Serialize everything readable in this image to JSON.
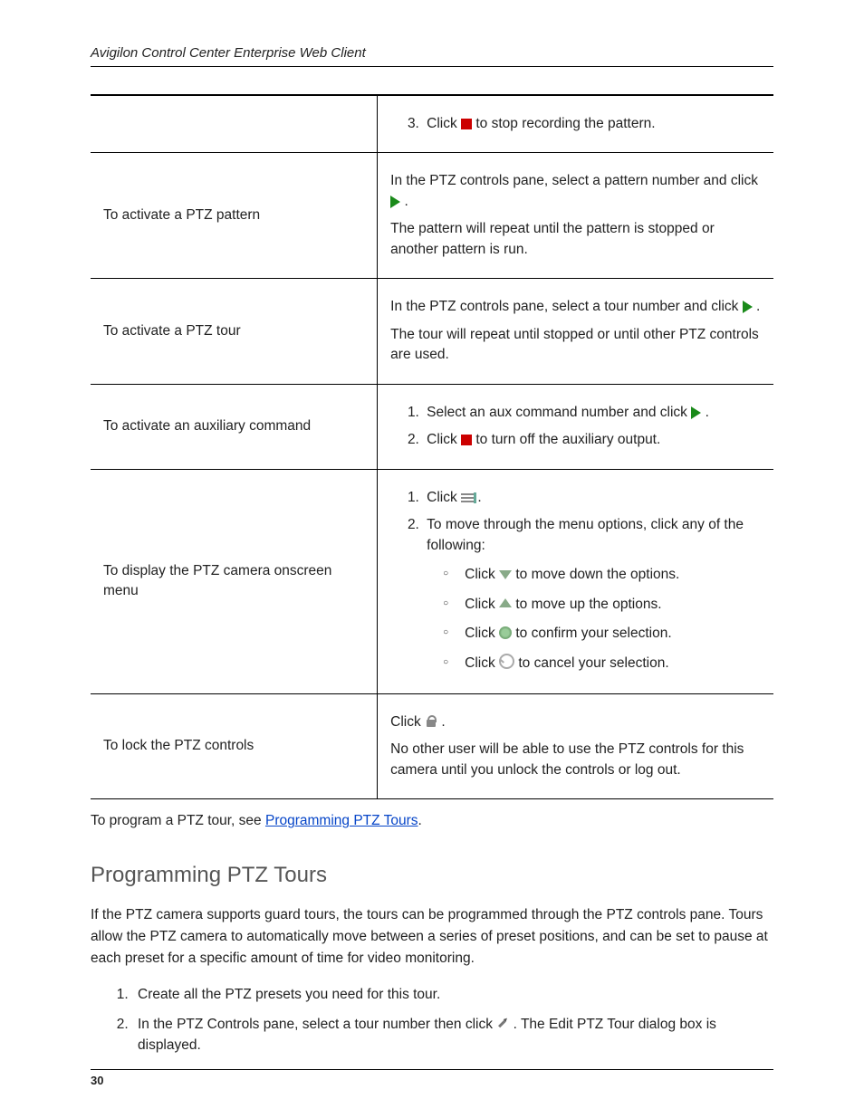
{
  "header": {
    "title": "Avigilon Control Center Enterprise Web Client"
  },
  "footer": {
    "page_number": "30"
  },
  "table": {
    "rows": [
      {
        "left": "",
        "right_list_start": 3,
        "right_items": [
          {
            "pre": "Click ",
            "icon": "stop-icon",
            "post": " to stop recording the pattern."
          }
        ]
      },
      {
        "left": "To activate a PTZ pattern",
        "right_paras": [
          {
            "pre": "In the PTZ controls pane, select a pattern number and click ",
            "icon": "play-icon",
            "post": "."
          },
          {
            "text": "The pattern will repeat until the pattern is stopped or another pattern is run."
          }
        ]
      },
      {
        "left": "To activate a PTZ tour",
        "right_paras": [
          {
            "pre": "In the PTZ controls pane, select a tour number and click ",
            "icon": "play-icon",
            "post": "."
          },
          {
            "text": "The tour will repeat until stopped or until other PTZ controls are used."
          }
        ]
      },
      {
        "left": "To activate an auxiliary command",
        "right_items_start": 1,
        "right_items": [
          {
            "pre": "Select an aux command number and click ",
            "icon": "play-icon",
            "post": "."
          },
          {
            "pre": "Click ",
            "icon": "stop-icon",
            "post": " to turn off the auxiliary output."
          }
        ]
      },
      {
        "left": "To display the PTZ camera onscreen menu",
        "right_items_start": 1,
        "right_items": [
          {
            "pre": "Click ",
            "icon": "menu-icon",
            "post": "."
          },
          {
            "text": "To move through the menu options, click any of the following:",
            "subitems": [
              {
                "pre": "Click ",
                "icon": "triangle-down-icon",
                "post": " to move down the options."
              },
              {
                "pre": "Click ",
                "icon": "triangle-up-icon",
                "post": " to move up the options."
              },
              {
                "pre": "Click ",
                "icon": "confirm-icon",
                "post": " to confirm your selection."
              },
              {
                "pre": "Click ",
                "icon": "cancel-icon",
                "post": " to cancel your selection."
              }
            ]
          }
        ]
      },
      {
        "left": "To lock the PTZ controls",
        "right_paras": [
          {
            "pre": "Click ",
            "icon": "lock-icon",
            "post": "."
          },
          {
            "text": "No other user will be able to use the PTZ controls for this camera until you unlock the controls or log out."
          }
        ]
      }
    ]
  },
  "after_table": {
    "pre": "To program a PTZ tour, see ",
    "link_text": "Programming PTZ Tours",
    "post": "."
  },
  "section": {
    "heading": "Programming PTZ Tours",
    "intro": "If the PTZ camera supports guard tours, the tours can be programmed through the PTZ controls pane. Tours allow the PTZ camera to automatically move between a series of preset positions, and can be set to pause at each preset for a specific amount of time for video monitoring.",
    "steps": [
      {
        "text": "Create all the PTZ presets you need for this tour."
      },
      {
        "pre": "In the PTZ Controls pane, select a tour number then click ",
        "icon": "pencil-icon",
        "post": " . The Edit PTZ Tour dialog box is displayed."
      }
    ]
  },
  "icons": {
    "stop-icon": "ic-stop",
    "play-icon": "ic-play",
    "menu-icon": "ic-menu",
    "triangle-down-icon": "ic-tri-down",
    "triangle-up-icon": "ic-tri-up",
    "confirm-icon": "ic-confirm",
    "cancel-icon": "ic-cancel",
    "lock-icon": "ic-lock",
    "pencil-icon": "ic-pencil"
  }
}
